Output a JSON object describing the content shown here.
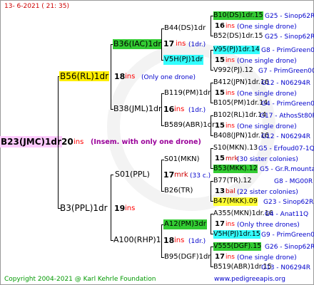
{
  "header": {
    "timestamp": "13-  6-2021 ( 21: 35)"
  },
  "root": {
    "name": "B23(JMC)1dr",
    "ins": "20",
    "ins_word": "ins",
    "note": "(Insem. with only one drone)"
  },
  "gen1": [
    {
      "name": "B56(RL)1dr",
      "ins": "18",
      "ins_word": "ins",
      "note": "(Only one drone)"
    },
    {
      "name": "B3(PPL)1dr",
      "ins": "19",
      "ins_word": "ins"
    }
  ],
  "gen2": [
    {
      "name": "B36(IAC)1dr",
      "ins": "",
      "ins_word": "",
      "note": ""
    },
    {
      "name": "B38(JML)1dr",
      "ins": "16",
      "ins_word": "ins",
      "note": "(1dr.)"
    },
    {
      "name": "S01(PPL)",
      "ins": "17",
      "ins_word": "mrk",
      "note": "(33 c.)"
    },
    {
      "name": "A100(RHP)1",
      "ins": "18",
      "ins_word": "ins",
      "note": "(1dr.)"
    }
  ],
  "gen3": [
    {
      "name": "B44(DS)1dr",
      "ins": "17",
      "ins_word": "ins",
      "note": "(1dr.)"
    },
    {
      "name": "V5H(PJ)1dr",
      "ins": "",
      "ins_word": "",
      "note": ""
    },
    {
      "name": "B119(PM)1dr",
      "ins": "",
      "ins_word": "",
      "note": ""
    },
    {
      "name": "B589(ABR)1dr",
      "ins": "",
      "ins_word": "",
      "note": ""
    },
    {
      "name": "S01(MKN)",
      "ins": "",
      "ins_word": "",
      "note": ""
    },
    {
      "name": "B26(TR)",
      "ins": "",
      "ins_word": "",
      "note": ""
    },
    {
      "name": "A12(PM)3dr",
      "ins": "",
      "ins_word": "",
      "note": ""
    },
    {
      "name": "B95(DGF)1dr",
      "ins": "",
      "ins_word": "",
      "note": ""
    }
  ],
  "gen4": [
    {
      "a": "B10(DS)1dr.15",
      "a_src": "G25 - Sinop62R",
      "ins": "16",
      "ins_word": "ins",
      "note": "(One single drone)",
      "b": "B52(DS)1dr.15",
      "b_src": "G25 - Sinop62R"
    },
    {
      "a": "V95(PJ)1dr.14",
      "a_src": "G8 - PrimGreen00",
      "ins": "15",
      "ins_word": "ins",
      "note": "(One single drone)",
      "b": "V992(PJ).12",
      "b_src": "G7 - PrimGreen00"
    },
    {
      "a": "B412(JPN)1dr.16",
      "a_src": "G12 - N06294R",
      "ins": "15",
      "ins_word": "ins",
      "note": "(One single drone)",
      "b": "B105(PM)1dr.14",
      "b_src": "G4 - PrimGreen00"
    },
    {
      "a": "B102(RL)1dr.14",
      "a_src": "G17 - AthosSt80R",
      "ins": "15",
      "ins_word": "ins",
      "note": "(One single drone)",
      "b": "B408(JPN)1dr.16",
      "b_src": "G12 - N06294R"
    },
    {
      "a": "S10(MKN).13",
      "a_src": "G5 - Erfoud07-1Q",
      "ins": "15",
      "ins_word": "mrk",
      "note": "(30 sister colonies)",
      "b": "B53(MKK).12",
      "b_src": "G5 - Gr.R.mounta"
    },
    {
      "a": "B77(TR).12",
      "a_src": "G8 - MG00R",
      "ins": "13",
      "ins_word": "bal",
      "note": "(22 sister colonies)",
      "b": "B47(MKK).09",
      "b_src": "G23 - Sinop62R"
    },
    {
      "a": "A355(MKN)1dr.16",
      "a_src": "G4 - Anat11Q",
      "ins": "17",
      "ins_word": "ins",
      "note": "(Only three drones)",
      "b": "V5H(PJ)1dr.15",
      "b_src": "G9 - PrimGreen00"
    },
    {
      "a": "V555(DGF).15",
      "a_src": "G26 - Sinop62R",
      "ins": "17",
      "ins_word": "ins",
      "note": "(One single drone)",
      "b": "B519(ABR)1dr.15",
      "b_src": "G13 - N06294R"
    }
  ],
  "footer": {
    "copyright": "Copyright 2004-2021 @ Karl Kehrle Foundation",
    "website": "www.pedigreeapis.org"
  },
  "colors": {
    "pink": "#ffccff",
    "yellow": "#ffee00",
    "green": "#33cc33",
    "cyan": "#33ffff",
    "red": "#ff0000",
    "blue": "#0000cc"
  }
}
